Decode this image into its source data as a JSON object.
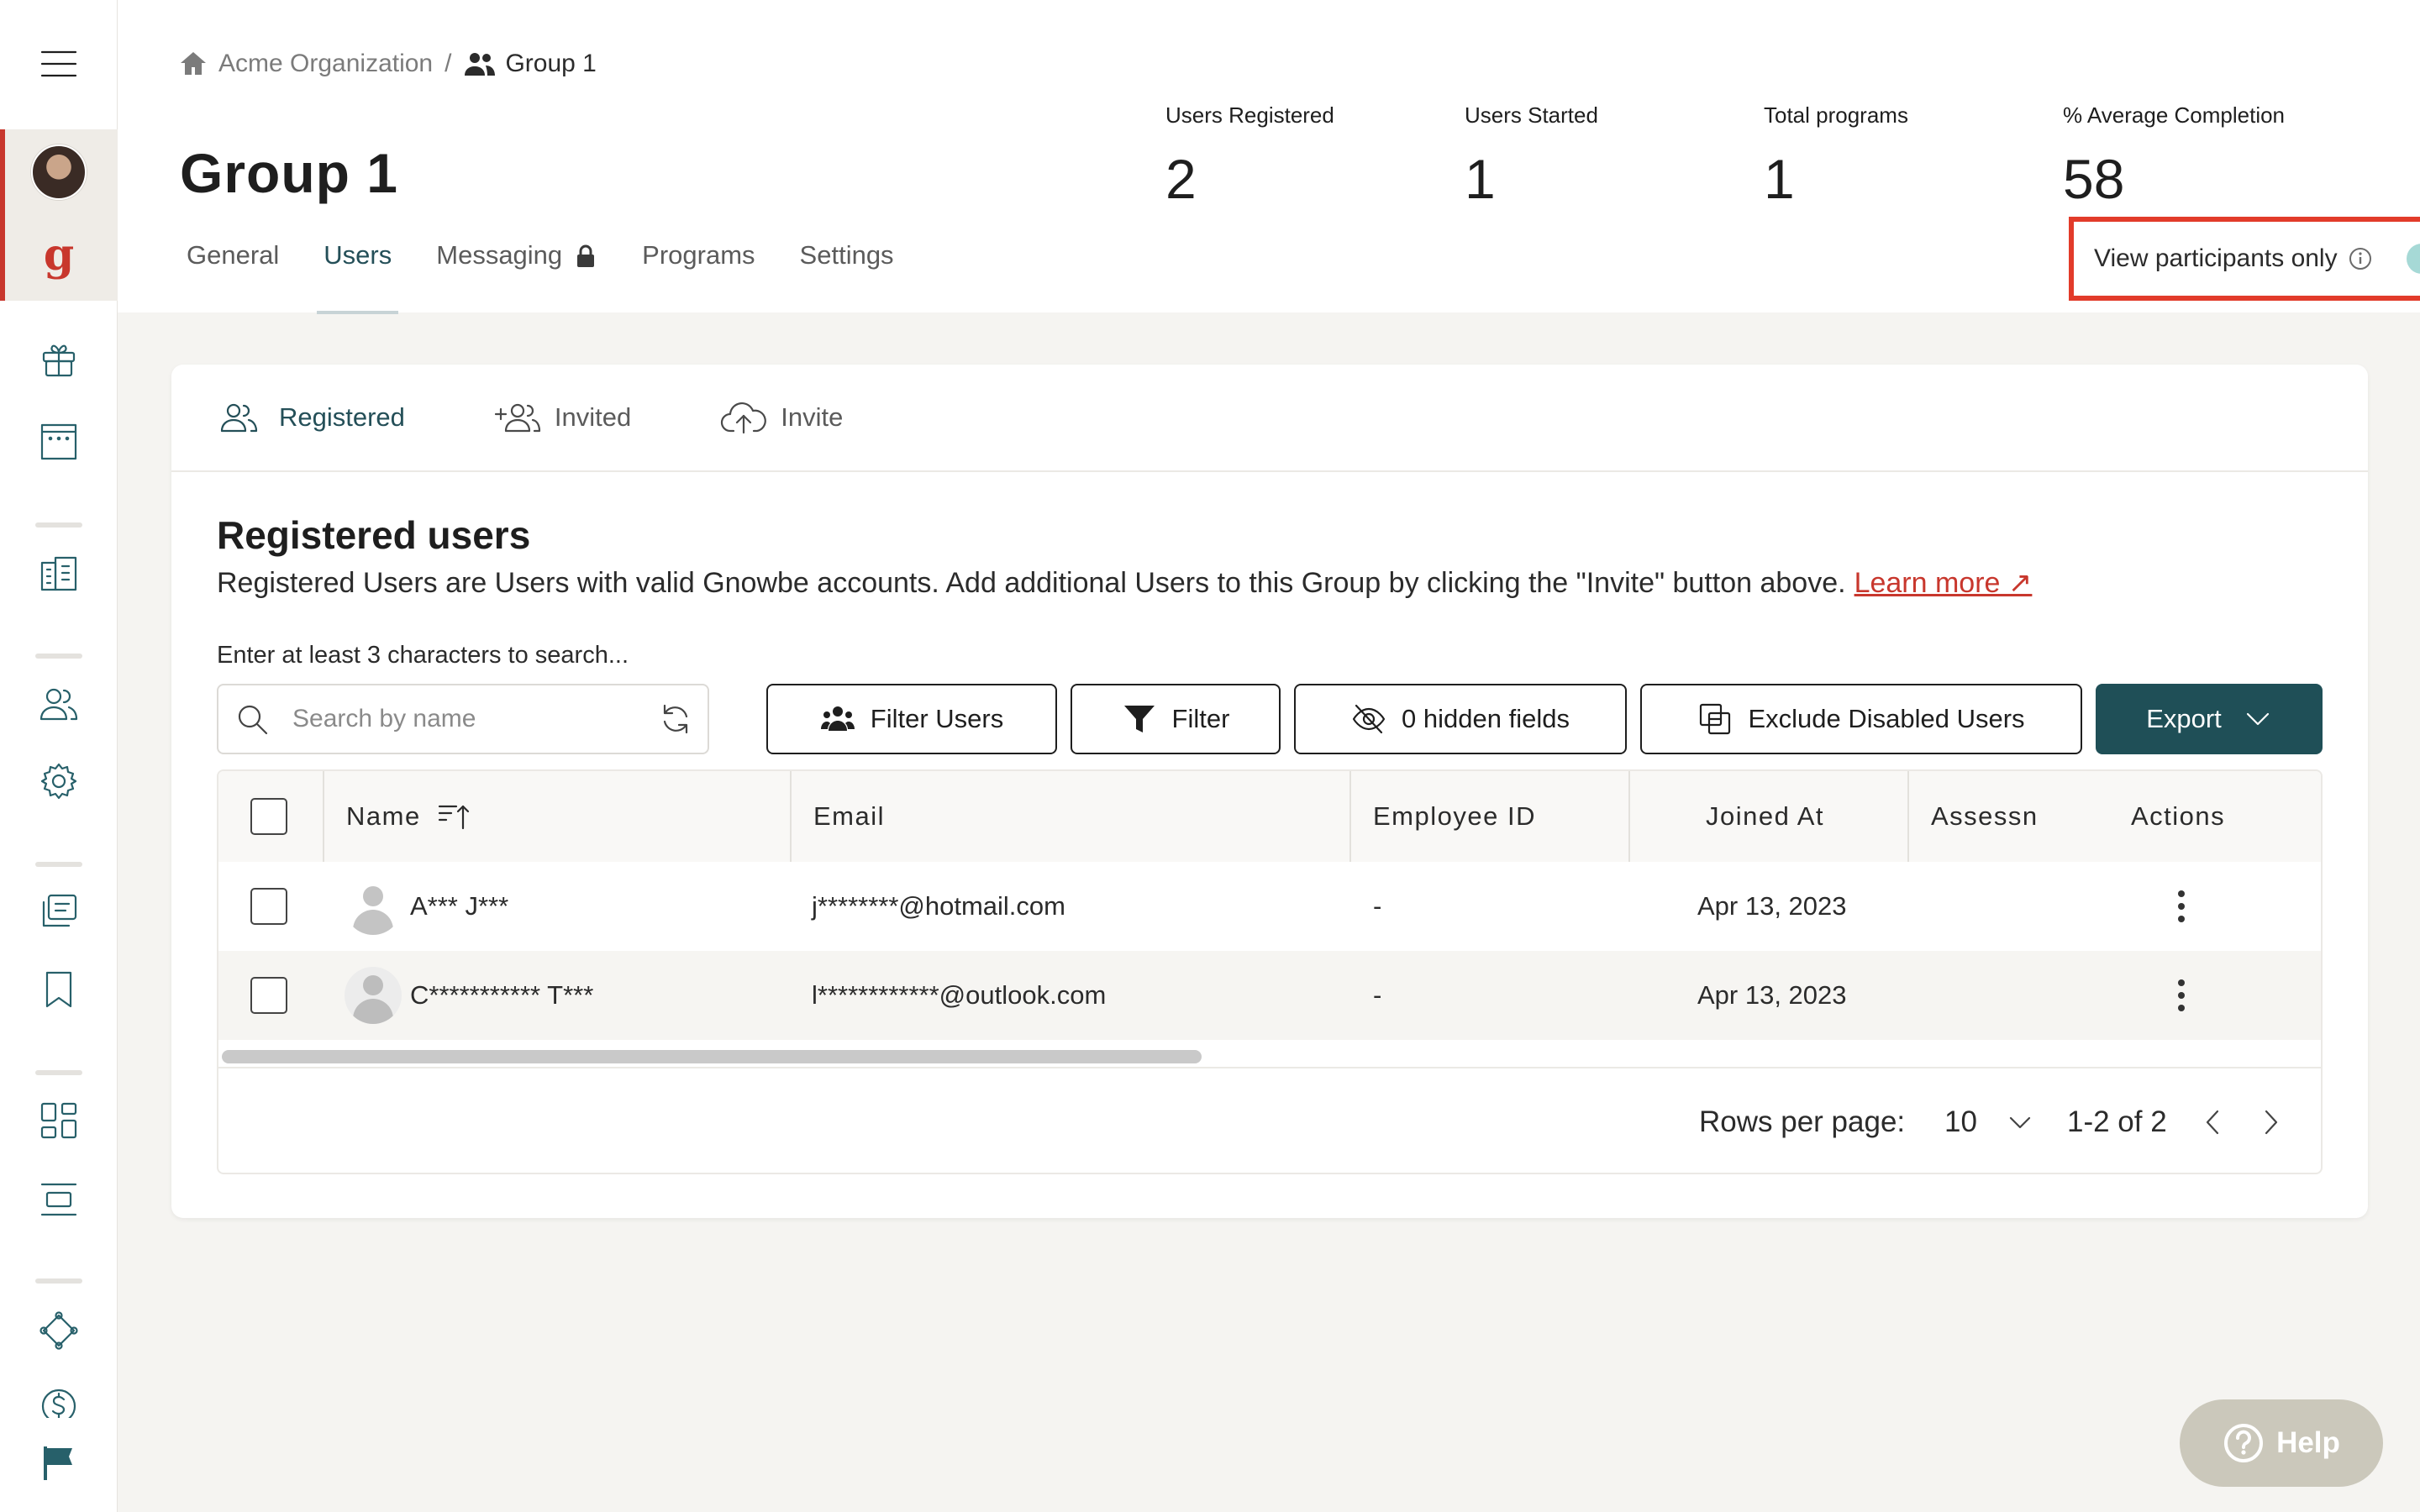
{
  "breadcrumb": {
    "org": "Acme Organization",
    "separator": "/",
    "group": "Group 1"
  },
  "page": {
    "title": "Group 1"
  },
  "tabs": [
    {
      "label": "General"
    },
    {
      "label": "Users"
    },
    {
      "label": "Messaging"
    },
    {
      "label": "Programs"
    },
    {
      "label": "Settings"
    }
  ],
  "active_tab": "Users",
  "stats": [
    {
      "label": "Users Registered",
      "value": "2"
    },
    {
      "label": "Users Started",
      "value": "1"
    },
    {
      "label": "Total programs",
      "value": "1"
    },
    {
      "label": "% Average Completion",
      "value": "58"
    }
  ],
  "participants_toggle": {
    "label": "View participants only",
    "on": true
  },
  "subtabs": [
    {
      "label": "Registered",
      "icon": "registered-users-icon"
    },
    {
      "label": "Invited",
      "icon": "invited-users-icon"
    },
    {
      "label": "Invite",
      "icon": "cloud-upload-icon"
    }
  ],
  "registered": {
    "title": "Registered users",
    "description": "Registered Users are Users with valid Gnowbe accounts. Add additional Users to this Group by clicking the \"Invite\" button above.",
    "learn_more": "Learn more ↗",
    "search_hint": "Enter at least 3 characters to search...",
    "search_placeholder": "Search by name"
  },
  "toolbar": {
    "filter_users": "Filter Users",
    "filter": "Filter",
    "hidden_fields": "0 hidden fields",
    "exclude_disabled": "Exclude Disabled Users",
    "export": "Export"
  },
  "table": {
    "columns": [
      "Name",
      "Email",
      "Employee ID",
      "Joined At",
      "Assessn",
      "Actions"
    ],
    "rows": [
      {
        "name": "A*** J***",
        "email": "j********@hotmail.com",
        "employee_id": "-",
        "joined_at": "Apr 13, 2023",
        "assessment": ""
      },
      {
        "name": "C*********** T***",
        "email": "l************@outlook.com",
        "employee_id": "-",
        "joined_at": "Apr 13, 2023",
        "assessment": ""
      }
    ]
  },
  "pagination": {
    "rows_label": "Rows per page:",
    "rows_value": "10",
    "range": "1-2 of 2"
  },
  "help": {
    "label": "Help"
  },
  "colors": {
    "accent": "#1f4f57",
    "brand_red": "#c8372d",
    "highlight": "#e23b2a",
    "toggle": "#63bfbb"
  }
}
